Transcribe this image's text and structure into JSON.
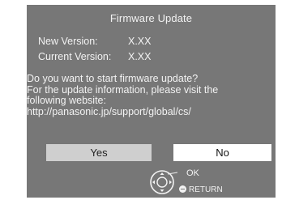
{
  "dialog": {
    "title": "Firmware Update",
    "new_version_label": "New Version:",
    "new_version_value": "X.XX",
    "current_version_label": "Current Version:",
    "current_version_value": "X.XX",
    "message_lines": [
      "Do you want to start firmware update?",
      "For the update information, please visit the",
      "following website:",
      "http://panasonic.jp/support/global/cs/"
    ],
    "yes_label": "Yes",
    "no_label": "No",
    "ok_hint": "OK",
    "return_hint": "RETURN"
  },
  "colors": {
    "dialog_bg": "#777777",
    "text": "#f2f2f2",
    "selected_button": "#cfcfcf",
    "unselected_button": "#ffffff"
  },
  "icons": [
    "dpad-ok-icon",
    "return-icon"
  ]
}
